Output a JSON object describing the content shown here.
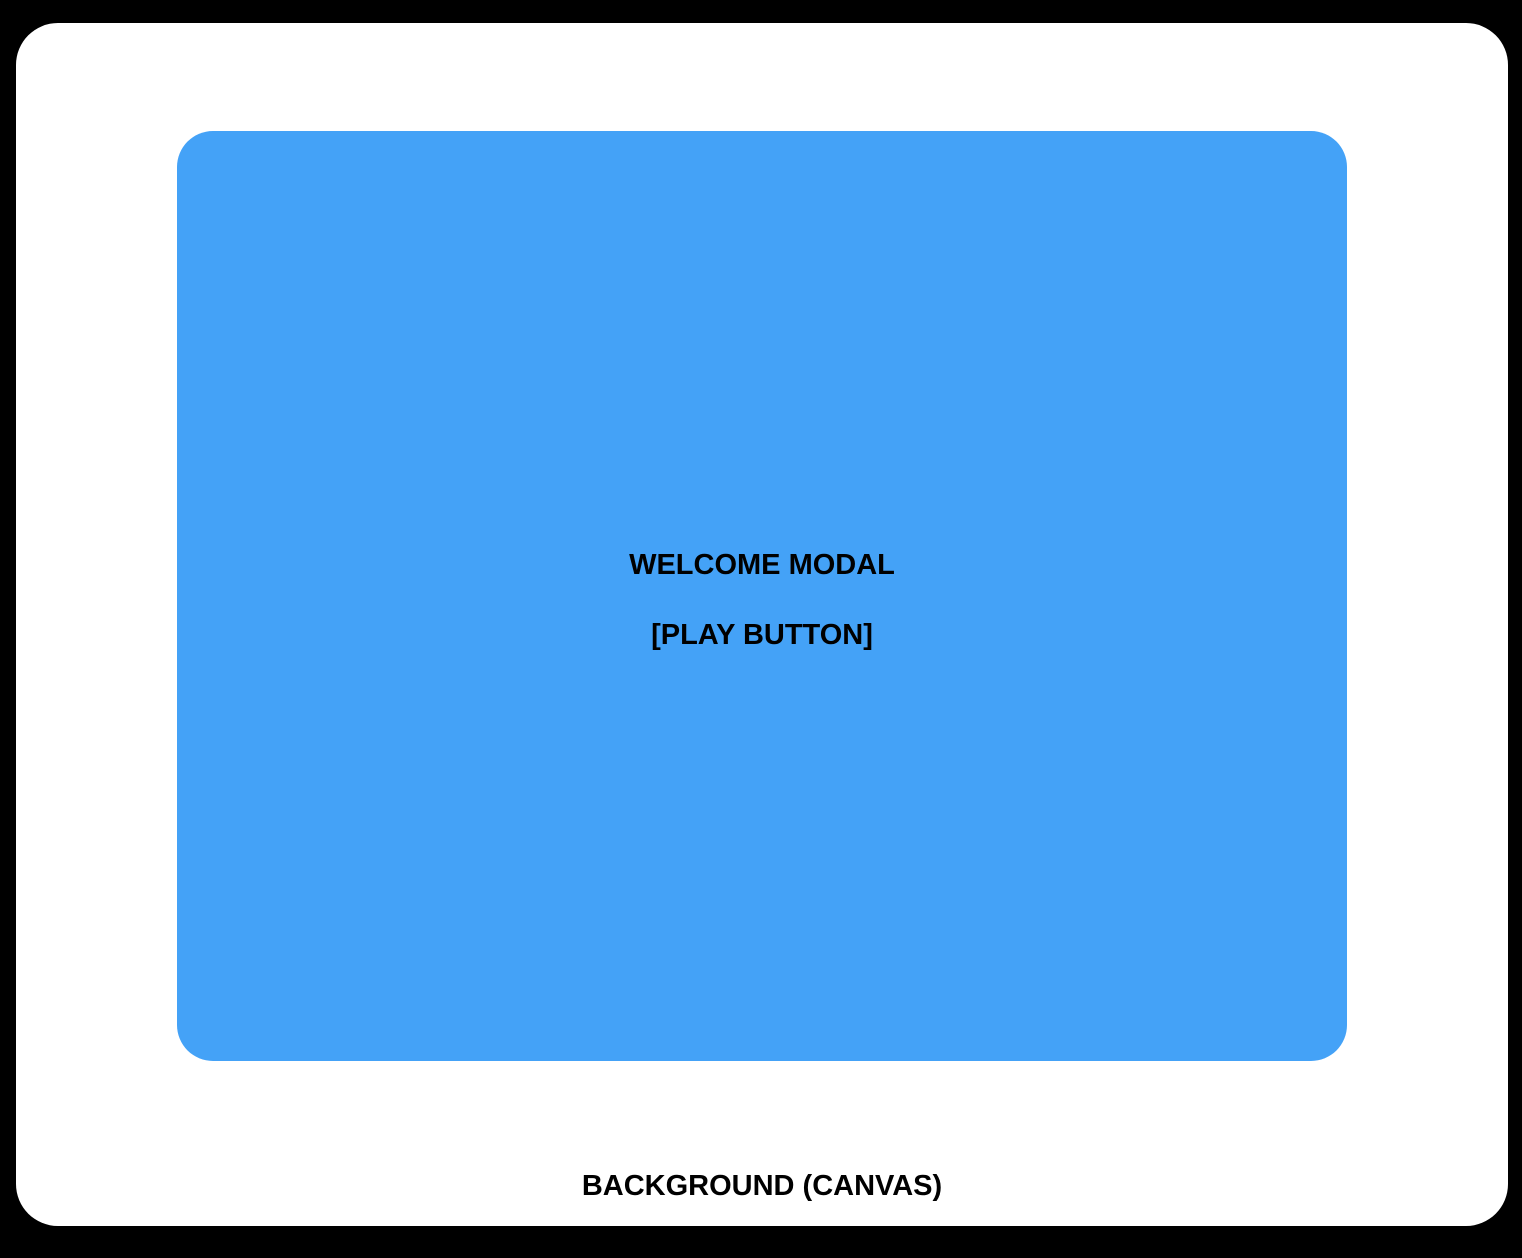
{
  "colors": {
    "frame": "#000000",
    "canvas": "#ffffff",
    "modal": "#44a2f7",
    "text": "#000000"
  },
  "modal": {
    "title": "WELCOME MODAL",
    "play_button_label": "[PLAY BUTTON]"
  },
  "canvas": {
    "label": "BACKGROUND (CANVAS)"
  }
}
